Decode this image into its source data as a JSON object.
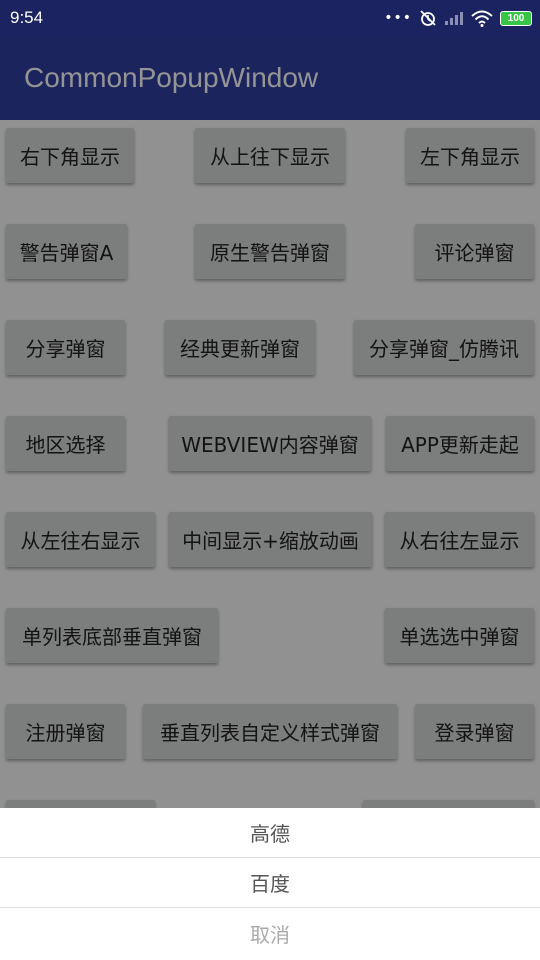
{
  "status_bar": {
    "time": "9:54",
    "battery": "100",
    "icons": [
      "more-dots-icon",
      "alarm-off-icon",
      "cellular-signal-icon",
      "wifi-icon",
      "battery-icon"
    ]
  },
  "app_bar": {
    "title": "CommonPopupWindow"
  },
  "buttons": [
    "右下角显示",
    "从上往下显示",
    "左下角显示",
    "警告弹窗A",
    "原生警告弹窗",
    "评论弹窗",
    "分享弹窗",
    "经典更新弹窗",
    "分享弹窗_仿腾讯",
    "地区选择",
    "WEBVIEW内容弹窗",
    "APP更新走起",
    "从左往右显示",
    "中间显示+缩放动画",
    "从右往左显示",
    "单列表底部垂直弹窗",
    "单选选中弹窗",
    "注册弹窗",
    "垂直列表自定义样式弹窗",
    "登录弹窗"
  ],
  "sheet": {
    "items": [
      "高德",
      "百度"
    ],
    "cancel": "取消"
  },
  "colors": {
    "status_bar": "#1b2361",
    "app_bar": "#303f9f",
    "button": "#d6d7d7",
    "battery": "#38c444"
  }
}
